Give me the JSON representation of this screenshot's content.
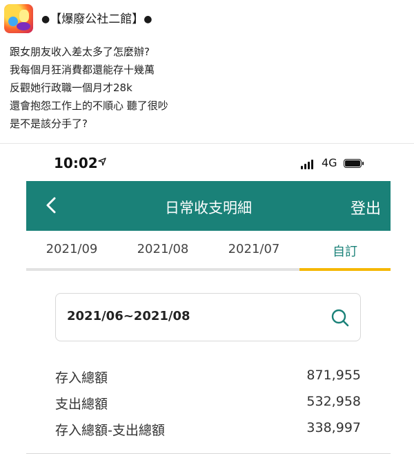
{
  "post": {
    "page_name": "【爆廢公社二館】",
    "lines": [
      "跟女朋友收入差太多了怎麼辦?",
      "我每個月狂消費都還能存十幾萬",
      "反觀她行政職一個月才28k",
      "還會抱怨工作上的不順心 聽了很吵",
      "是不是該分手了?"
    ]
  },
  "phone": {
    "status": {
      "time": "10:02",
      "network": "4G"
    },
    "app_bar": {
      "title": "日常收支明細",
      "logout_label": "登出"
    },
    "tabs": [
      {
        "label": "2021/09"
      },
      {
        "label": "2021/08"
      },
      {
        "label": "2021/07"
      },
      {
        "label": "自訂"
      }
    ],
    "active_tab": "自訂",
    "date_range": "2021/06~2021/08",
    "summary": [
      {
        "label": "存入總額",
        "value": "871,955"
      },
      {
        "label": "支出總額",
        "value": "532,958"
      },
      {
        "label": "存入總額-支出總額",
        "value": "338,997"
      }
    ]
  },
  "colors": {
    "teal": "#1a8178",
    "tab_underline": "#f5b700"
  },
  "icons": [
    "location-arrow-icon",
    "signal-icon",
    "battery-icon",
    "back-arrow-icon",
    "search-icon"
  ]
}
